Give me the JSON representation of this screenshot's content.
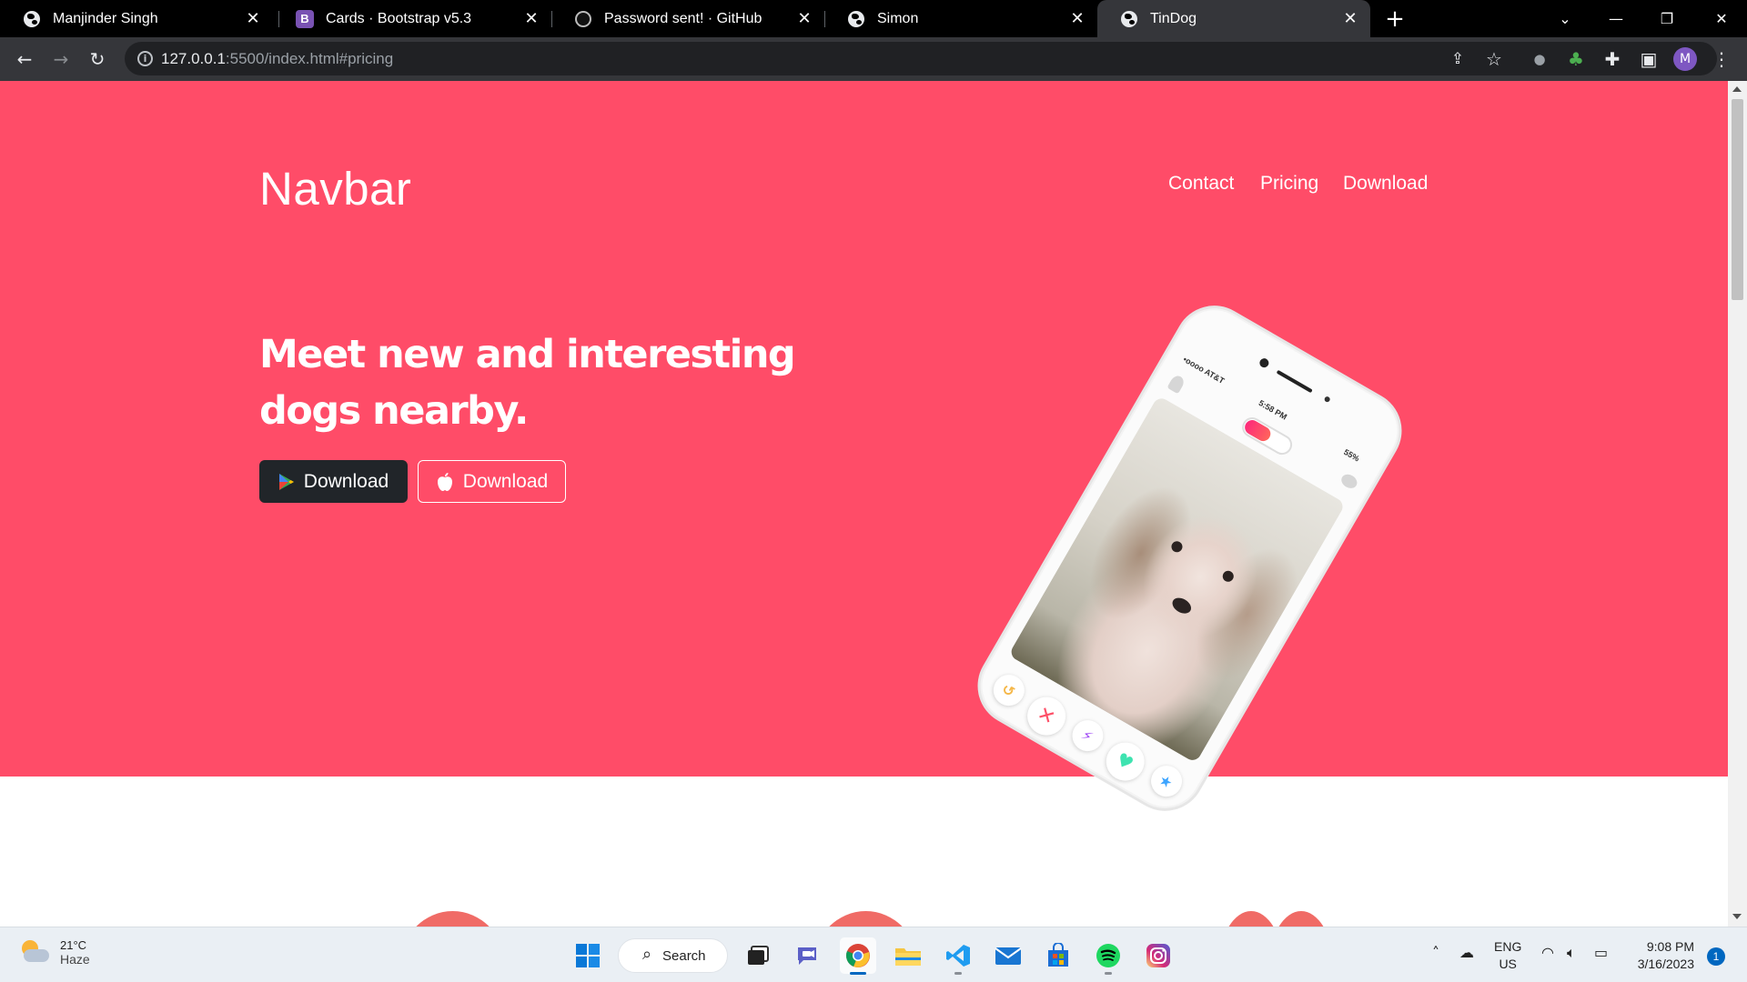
{
  "browser": {
    "tabs": [
      {
        "title": "Manjinder Singh",
        "icon": "globe-icon"
      },
      {
        "title": "Cards · Bootstrap v5.3",
        "icon": "bootstrap-icon"
      },
      {
        "title": "Password sent! · GitHub",
        "icon": "github-icon"
      },
      {
        "title": "Simon",
        "icon": "globe-icon"
      },
      {
        "title": "TinDog",
        "icon": "globe-icon",
        "active": true
      }
    ],
    "url_host": "127.0.0.1",
    "url_rest": ":5500/index.html#pricing",
    "profile_initial": "M"
  },
  "page": {
    "brand": "Navbar",
    "nav": [
      "Contact",
      "Pricing",
      "Download"
    ],
    "headline_line1": "Meet new and interesting",
    "headline_line2": "dogs nearby.",
    "buttons": {
      "google": "Download",
      "apple": "Download"
    },
    "colors": {
      "hero": "#ff4c68",
      "dark_button": "#212529"
    },
    "phone": {
      "carrier": "•oooo AT&T",
      "time": "5:58 PM",
      "battery": "55%"
    }
  },
  "taskbar": {
    "weather": {
      "temp": "21°C",
      "condition": "Haze"
    },
    "search_label": "Search",
    "lang_line1": "ENG",
    "lang_line2": "US",
    "time": "9:08 PM",
    "date": "3/16/2023",
    "notifications": "1"
  }
}
